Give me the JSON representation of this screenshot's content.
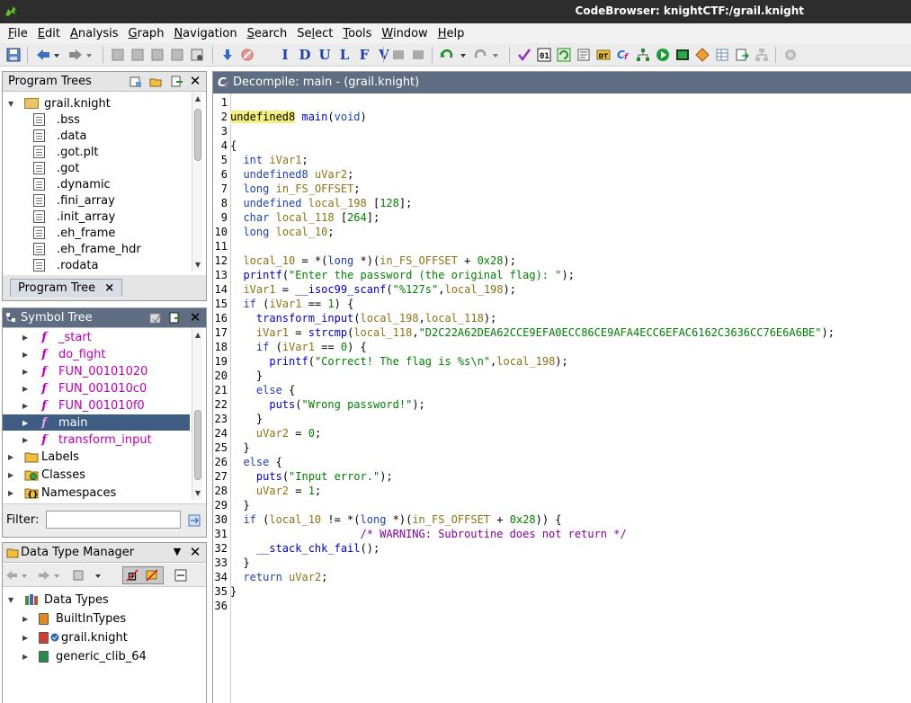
{
  "window": {
    "title": "CodeBrowser: knightCTF:/grail.knight"
  },
  "menu": [
    {
      "pre": "",
      "u": "F",
      "post": "ile"
    },
    {
      "pre": "",
      "u": "E",
      "post": "dit"
    },
    {
      "pre": "",
      "u": "A",
      "post": "nalysis"
    },
    {
      "pre": "",
      "u": "G",
      "post": "raph"
    },
    {
      "pre": "",
      "u": "N",
      "post": "avigation"
    },
    {
      "pre": "",
      "u": "S",
      "post": "earch"
    },
    {
      "pre": "Se",
      "u": "l",
      "post": "ect"
    },
    {
      "pre": "",
      "u": "T",
      "post": "ools"
    },
    {
      "pre": "",
      "u": "W",
      "post": "indow"
    },
    {
      "pre": "",
      "u": "H",
      "post": "elp"
    }
  ],
  "toolbar_letters": [
    "I",
    "D",
    "U",
    "L",
    "F",
    "V"
  ],
  "program_trees": {
    "title": "Program Trees",
    "root": "grail.knight",
    "sections": [
      ".bss",
      ".data",
      ".got.plt",
      ".got",
      ".dynamic",
      ".fini_array",
      ".init_array",
      ".eh_frame",
      ".eh_frame_hdr",
      ".rodata"
    ],
    "tab_label": "Program Tree",
    "tab_close": "×"
  },
  "symbol_tree": {
    "title": "Symbol Tree",
    "functions": [
      "_start",
      "do_fight",
      "FUN_00101020",
      "FUN_001010c0",
      "FUN_001010f0",
      "main",
      "transform_input"
    ],
    "selected": "main",
    "categories": [
      "Labels",
      "Classes",
      "Namespaces"
    ],
    "filter_label": "Filter:",
    "filter_value": ""
  },
  "data_type_manager": {
    "title": "Data Type Manager",
    "root": "Data Types",
    "items": [
      "BuiltInTypes",
      "grail.knight",
      "generic_clib_64"
    ]
  },
  "decompiler": {
    "title": "Decompile: main -  (grail.knight)",
    "lines": [
      "",
      "undefined8 main(void)",
      "",
      "{",
      "  int iVar1;",
      "  undefined8 uVar2;",
      "  long in_FS_OFFSET;",
      "  undefined local_198 [128];",
      "  char local_118 [264];",
      "  long local_10;",
      "",
      "  local_10 = *(long *)(in_FS_OFFSET + 0x28);",
      "  printf(\"Enter the password (the original flag): \");",
      "  iVar1 = __isoc99_scanf(\"%127s\",local_198);",
      "  if (iVar1 == 1) {",
      "    transform_input(local_198,local_118);",
      "    iVar1 = strcmp(local_118,\"D2C22A62DEA62CCE9EFA0ECC86CE9AFA4ECC6EFAC6162C3636CC76E6A6BE\");",
      "    if (iVar1 == 0) {",
      "      printf(\"Correct! The flag is %s\\n\",local_198);",
      "    }",
      "    else {",
      "      puts(\"Wrong password!\");",
      "    }",
      "    uVar2 = 0;",
      "  }",
      "  else {",
      "    puts(\"Input error.\");",
      "    uVar2 = 1;",
      "  }",
      "  if (local_10 != *(long *)(in_FS_OFFSET + 0x28)) {",
      "                    /* WARNING: Subroutine does not return */",
      "    __stack_chk_fail();",
      "  }",
      "  return uVar2;",
      "}",
      ""
    ]
  },
  "colors": {
    "keyword": "#1d3faf",
    "variable": "#8a7314",
    "string": "#008000",
    "function": "#0000c8",
    "comment": "#8700a0",
    "selection": "#3f5d83",
    "function_icon": "#ba00b4"
  }
}
